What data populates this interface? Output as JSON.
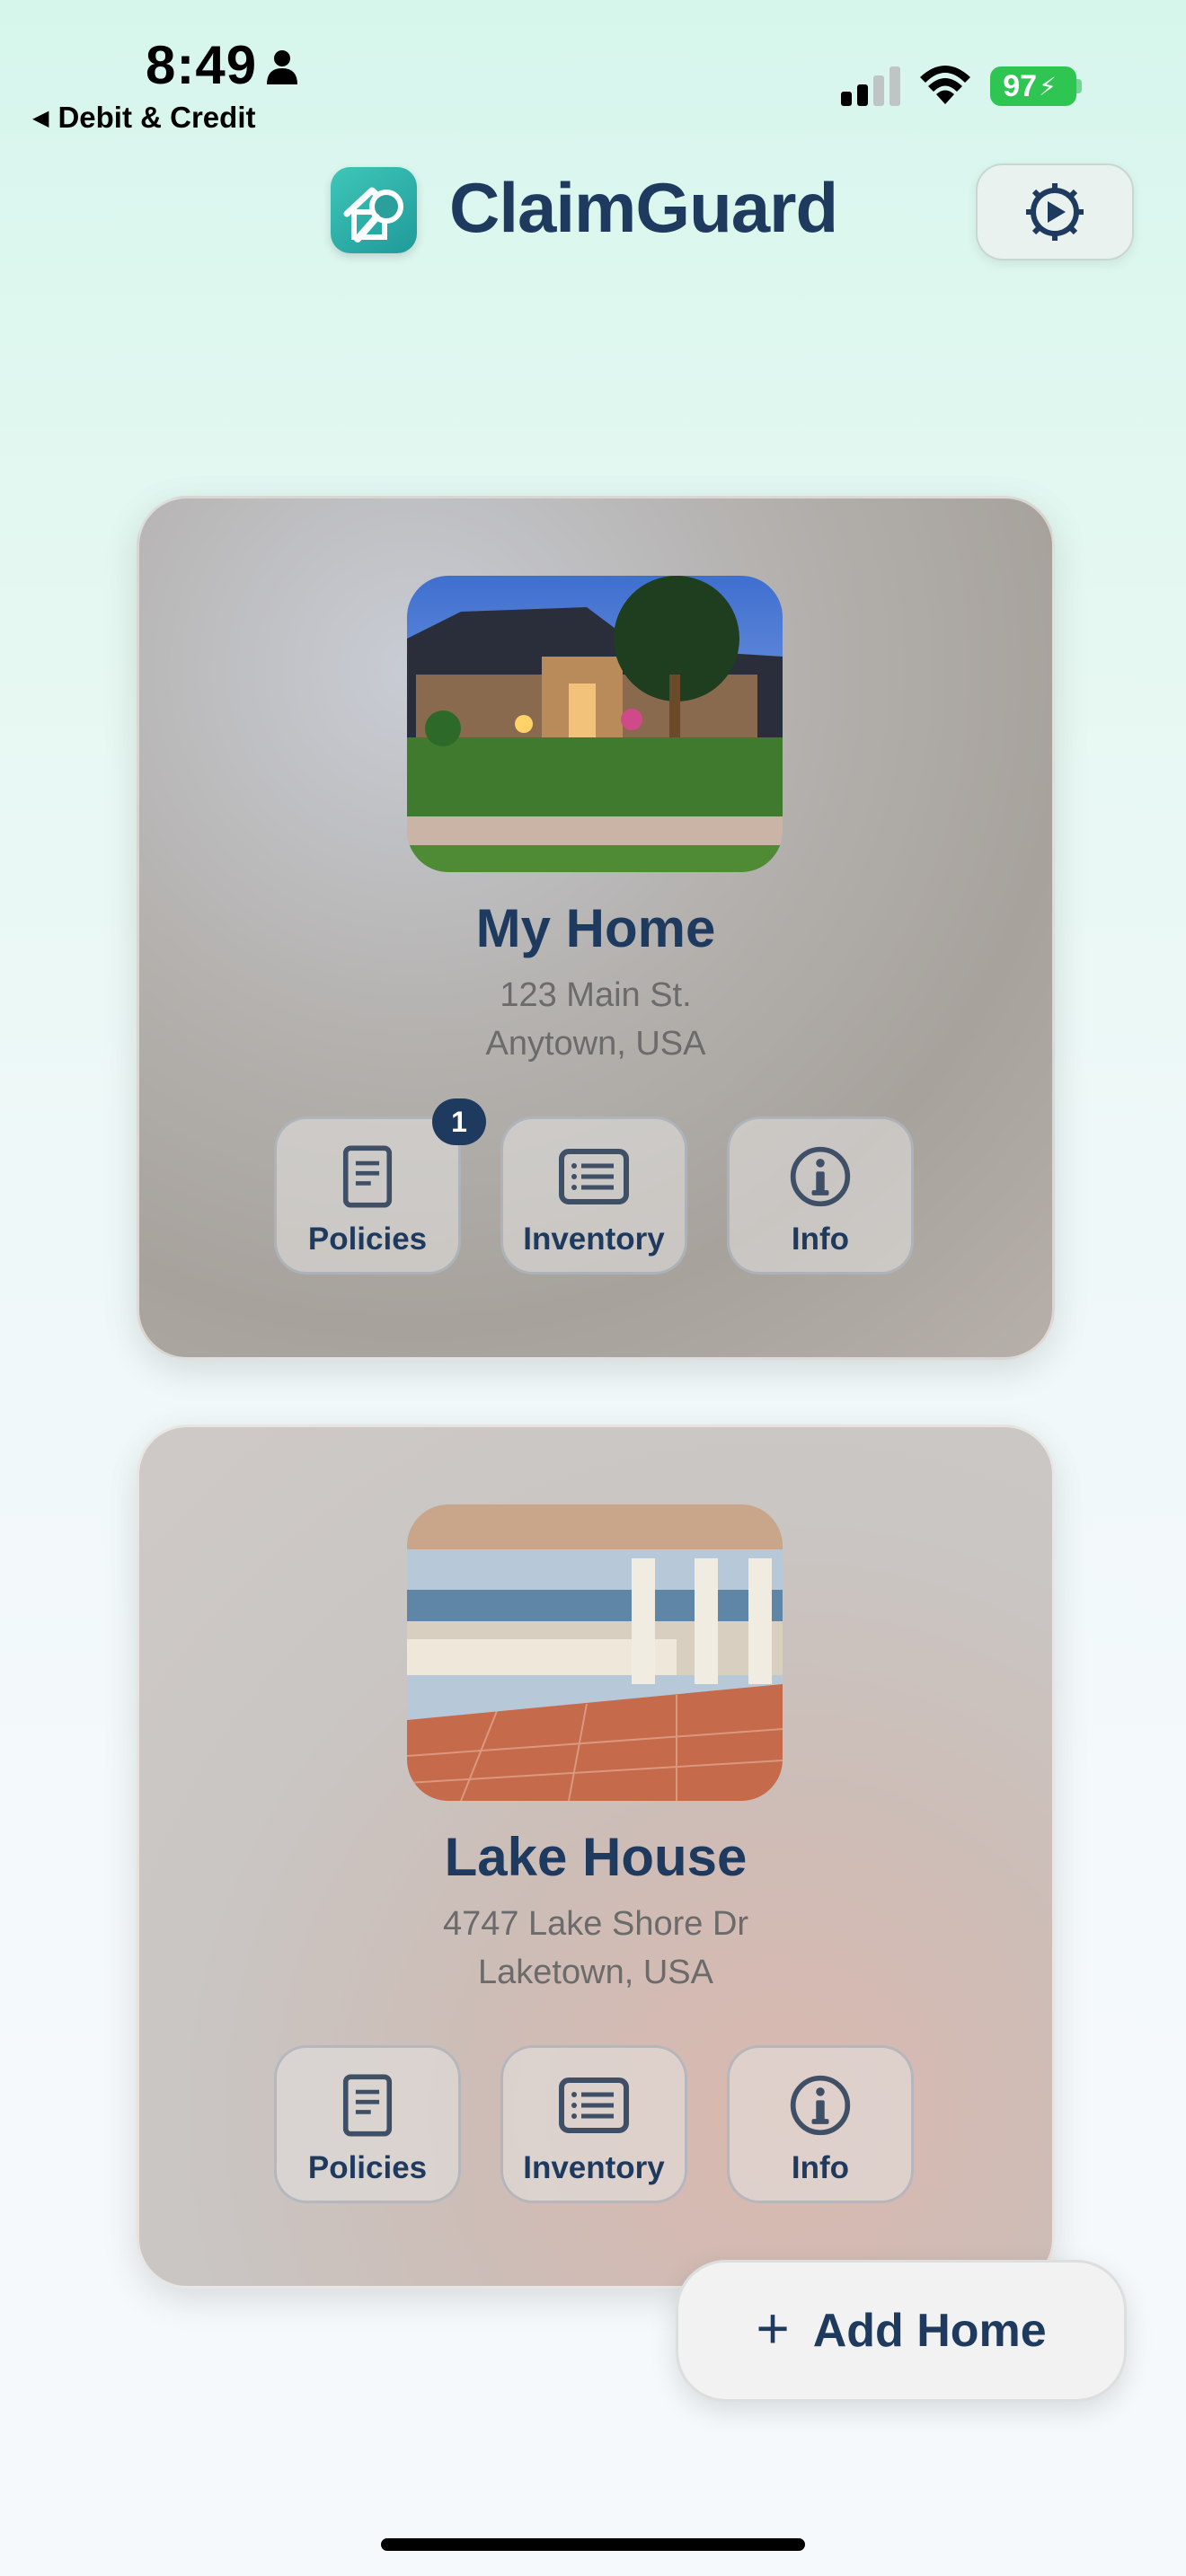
{
  "status_bar": {
    "time": "8:49",
    "back_label": "Debit & Credit",
    "battery": "97"
  },
  "header": {
    "app_title": "ClaimGuard"
  },
  "homes": [
    {
      "name": "My Home",
      "address_line1": "123 Main St.",
      "address_line2": "Anytown, USA",
      "policies_badge": "1",
      "actions": [
        "Policies",
        "Inventory",
        "Info"
      ]
    },
    {
      "name": "Lake House",
      "address_line1": "4747 Lake Shore Dr",
      "address_line2": "Laketown, USA",
      "actions": [
        "Policies",
        "Inventory",
        "Info"
      ]
    }
  ],
  "add_home_label": "Add Home",
  "colors": {
    "accent": "#1f3a5f",
    "battery": "#2fc553",
    "logo": "#2bb3a8"
  }
}
